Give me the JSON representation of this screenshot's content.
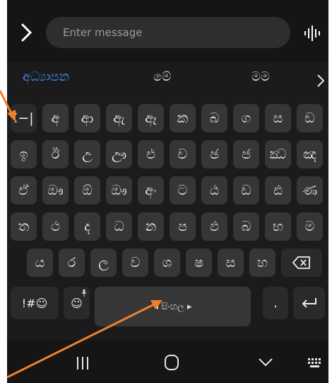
{
  "input": {
    "placeholder": "Enter message"
  },
  "suggestions": {
    "first": "අධ්‍යාපන",
    "second": "මේ",
    "third": "මම"
  },
  "rows": [
    [
      "⁚−|",
      "අ",
      "ආ",
      "ඇ",
      "ඈ",
      "ක",
      "බ",
      "ග",
      "ස",
      "ඞ"
    ],
    [
      "ඉ",
      "ඊ",
      "උ",
      "ඌ",
      "එ",
      "ච",
      "ඡ",
      "ජ",
      "ඣ",
      "ඤ"
    ],
    [
      "ඒ",
      "ඖ",
      "ඕ",
      "ඖ",
      "අං",
      "ට",
      "ඨ",
      "ඩ",
      "ඪ",
      "ණ"
    ],
    [
      "ත",
      "ථ",
      "ද",
      "ධ",
      "න",
      "ප",
      "ඵ",
      "බ",
      "භ",
      "ම"
    ],
    [
      "ය",
      "ර",
      "ල",
      "ව",
      "ශ",
      "ෂ",
      "ස",
      "හ"
    ]
  ],
  "bottom": {
    "symbols": "!#☺",
    "emoji": "☺",
    "space": "◂ සිංහල ▸",
    "period": "."
  },
  "colors": {
    "accent": "#3e8ee8",
    "arrow": "#f07f2c",
    "key": "#363636",
    "background": "#151515"
  },
  "icons": [
    "chevron-right-icon",
    "voice-input-icon",
    "backspace-icon",
    "enter-icon",
    "microphone-icon",
    "recent-apps-icon",
    "home-icon",
    "back-chevron-icon",
    "keyboard-icon",
    "annotation-arrow"
  ]
}
